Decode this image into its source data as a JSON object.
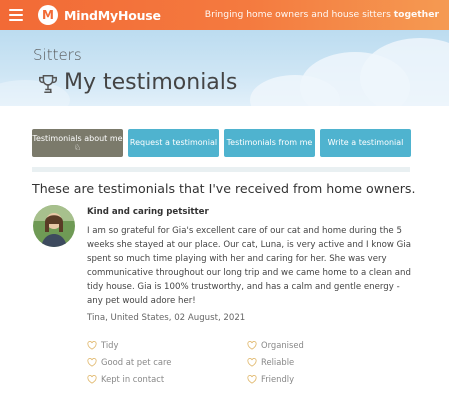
{
  "header": {
    "brand": "MindMyHouse",
    "logo_letter": "M",
    "tagline_prefix": "Bringing home owners and house sitters",
    "tagline_bold": "together",
    "accent_color": "#f26a36"
  },
  "hero": {
    "section": "Sitters",
    "title": "My testimonials"
  },
  "tabs": [
    {
      "label": "Testimonials about me ♘",
      "active": true
    },
    {
      "label": "Request a testimonial",
      "active": false
    },
    {
      "label": "Testimonials from me",
      "active": false
    },
    {
      "label": "Write a testimonial",
      "active": false
    }
  ],
  "content": {
    "heading": "These are testimonials that I've received from home owners.",
    "testimonial": {
      "title": "Kind and caring petsitter",
      "body": "I am so grateful for Gia's excellent care of our cat and home during the 5 weeks she stayed at our place. Our cat, Luna, is very active and I know Gia spent so much time playing with her and caring for her. She was very communicative throughout our long trip and we came home to a clean and tidy house. Gia is 100% trustworthy, and has a calm and gentle energy - any pet would adore her!",
      "meta": "Tina, United States, 02 August, 2021",
      "qualities": [
        "Tidy",
        "Organised",
        "Good at pet care",
        "Reliable",
        "Kept in contact",
        "Friendly"
      ]
    }
  },
  "icons": {
    "menu": "hamburger-icon",
    "trophy": "trophy-icon",
    "heart": "heart-outline-icon"
  },
  "colors": {
    "tab_active": "#7b7a6b",
    "tab_inactive": "#4fb3cf",
    "heart": "#e0b76a"
  }
}
